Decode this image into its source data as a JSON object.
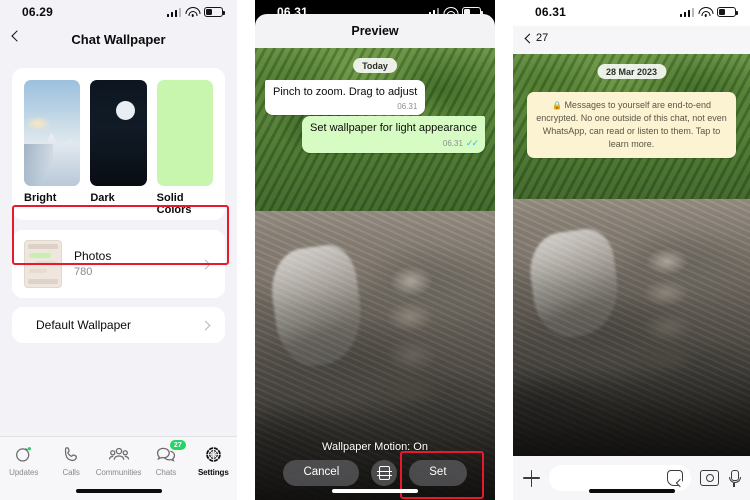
{
  "panel1": {
    "status": {
      "time": "06.29",
      "icons": [
        "signal-icon",
        "wifi-icon",
        "battery-icon"
      ]
    },
    "nav": {
      "back_icon": "chevron-left-icon",
      "title": "Chat Wallpaper"
    },
    "wallpaper_options": [
      {
        "label": "Bright",
        "kind": "photo-mountain"
      },
      {
        "label": "Dark",
        "kind": "photo-moon"
      },
      {
        "label": "Solid Colors",
        "kind": "solid-green",
        "color": "#c8f6ae"
      }
    ],
    "rows": [
      {
        "title": "Photos",
        "subtitle": "780",
        "chevron": "chevron-right-icon",
        "highlighted": true
      },
      {
        "title": "Default Wallpaper",
        "subtitle": "",
        "chevron": "chevron-right-icon",
        "highlighted": false
      }
    ],
    "highlight_color": "#e8192c",
    "tabbar": [
      {
        "label": "Updates",
        "icon": "updates-icon",
        "badge": "",
        "active": false
      },
      {
        "label": "Calls",
        "icon": "phone-icon",
        "badge": "",
        "active": false
      },
      {
        "label": "Communities",
        "icon": "communities-icon",
        "badge": "",
        "active": false
      },
      {
        "label": "Chats",
        "icon": "chats-icon",
        "badge": "27",
        "active": false
      },
      {
        "label": "Settings",
        "icon": "gear-icon",
        "badge": "",
        "active": true
      }
    ],
    "badge_color": "#25d366"
  },
  "panel2": {
    "status": {
      "time": "06.31",
      "icons": [
        "signal-icon",
        "wifi-icon",
        "battery-icon"
      ]
    },
    "sheet_title": "Preview",
    "day_pill": "Today",
    "messages": [
      {
        "direction": "incoming",
        "text": "Pinch to zoom. Drag to adjust",
        "time": "06.31",
        "ticks": false
      },
      {
        "direction": "outgoing",
        "text": "Set wallpaper for light appearance",
        "time": "06.31",
        "ticks": true
      }
    ],
    "motion_label": "Wallpaper Motion: On",
    "buttons": {
      "cancel": "Cancel",
      "motion_toggle_icon": "motion-icon",
      "set": "Set"
    },
    "highlight_color": "#e8192c",
    "outgoing_bubble_color": "#d7fcc3"
  },
  "panel3": {
    "status": {
      "time": "06.31",
      "icons": [
        "signal-icon",
        "wifi-icon",
        "battery-icon"
      ]
    },
    "nav": {
      "back_icon": "chevron-left-icon",
      "back_count": "27"
    },
    "date_pill": "28 Mar 2023",
    "encryption_notice": {
      "lock_icon": "lock-icon",
      "text": "Messages to yourself are end-to-end encrypted. No one outside of this chat, not even WhatsApp, can read or listen to them. Tap to learn more."
    },
    "input_bar": {
      "plus_icon": "plus-icon",
      "placeholder": "",
      "value": "",
      "sticker_icon": "sticker-icon",
      "camera_icon": "camera-icon",
      "mic_icon": "mic-icon"
    }
  }
}
